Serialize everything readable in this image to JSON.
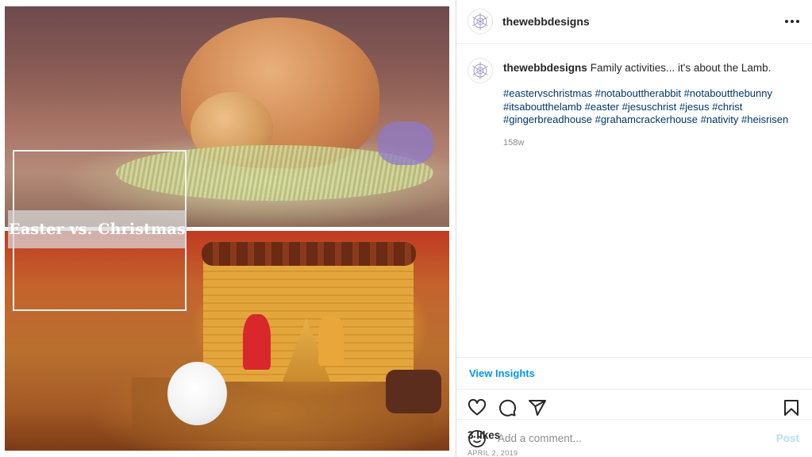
{
  "post": {
    "image_title": "Easter vs. Christmas",
    "username": "thewebbdesigns",
    "caption_text": "Family activities... it's about the Lamb.",
    "hashtags": [
      "#eastervschristmas",
      "#notabouttherabbit",
      "#notaboutthebunny",
      "#itsaboutthelamb",
      "#easter",
      "#jesuschrist",
      "#jesus",
      "#christ",
      "#gingerbreadhouse",
      "#grahamcrackerhouse",
      "#nativity",
      "#heisrisen"
    ],
    "caption_age": "158w",
    "view_insights": "View Insights",
    "likes": "3 likes",
    "date": "APRIL 2, 2019",
    "add_comment_placeholder": "Add a comment...",
    "post_button": "Post"
  },
  "icons": {
    "avatar": "snowflake-avatar-icon",
    "more": "more-options-icon",
    "like": "heart-icon",
    "comment": "comment-icon",
    "share": "share-icon",
    "save": "bookmark-icon",
    "emoji": "emoji-icon"
  },
  "colors": {
    "link": "#00376b",
    "accent": "#0095f6",
    "post_disabled": "#b2dffc",
    "muted": "#8e8e8e"
  }
}
